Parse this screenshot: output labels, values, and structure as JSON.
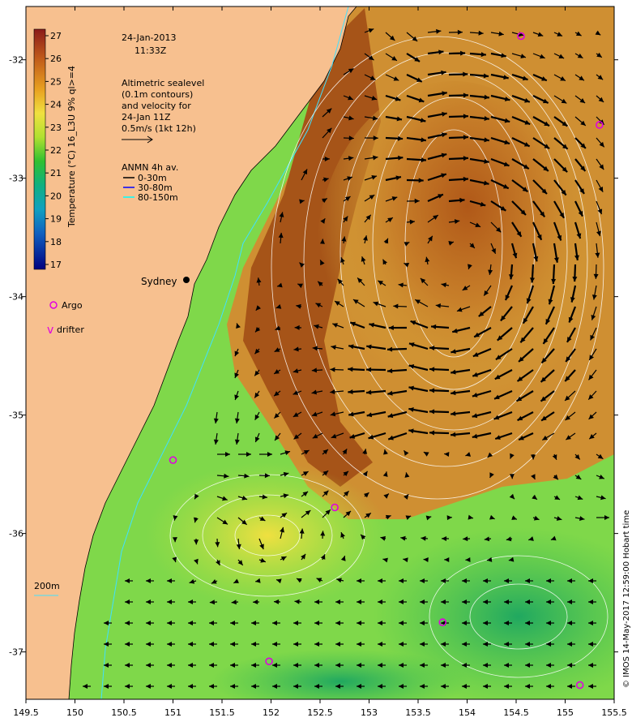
{
  "date_line1": "24-Jan-2013",
  "date_line2": "11:33Z",
  "altimetry_note": [
    "Altimetric sealevel",
    "(0.1m contours)",
    "and velocity for",
    "24-Jan 11Z",
    "0.5m/s (1kt 12h)"
  ],
  "anmn_title": "ANMN 4h av.",
  "anmn_legend": [
    {
      "label": "0-30m",
      "color": "#000000"
    },
    {
      "label": "30-80m",
      "color": "#0000ff"
    },
    {
      "label": "80-150m",
      "color": "#00ffff"
    }
  ],
  "city_label": "Sydney",
  "argo_label": "Argo",
  "drifter_label": "drifter",
  "isobath_label": "200m",
  "colorbar_title": "Temperature (°C) 16_L3U 9% ql>=4",
  "colorbar_ticks": [
    "27",
    "26",
    "25",
    "24",
    "23",
    "22",
    "21",
    "20",
    "19",
    "18",
    "17"
  ],
  "credit": "© IMOS 14-May-2017 12:59:00 Hobart time",
  "x_ticks": [
    "149.5",
    "150",
    "150.5",
    "151",
    "151.5",
    "152",
    "152.5",
    "153",
    "153.5",
    "154",
    "154.5",
    "155",
    "155.5"
  ],
  "y_ticks": [
    "-32",
    "-33",
    "-34",
    "-35",
    "-36",
    "-37"
  ],
  "colors": {
    "land": "#f7c08f",
    "warm": "#b85a1c",
    "mid": "#d9a43a",
    "cool": "#7fd84a",
    "cold": "#2fbf6c",
    "argo": "#e000e0"
  },
  "argo_floats": [
    {
      "lon": 154.55,
      "lat": -31.8
    },
    {
      "lon": 155.35,
      "lat": -32.55
    },
    {
      "lon": 151.0,
      "lat": -35.38
    },
    {
      "lon": 152.65,
      "lat": -35.78
    },
    {
      "lon": 153.75,
      "lat": -36.75
    },
    {
      "lon": 151.98,
      "lat": -37.08
    },
    {
      "lon": 155.15,
      "lat": -37.28
    }
  ]
}
